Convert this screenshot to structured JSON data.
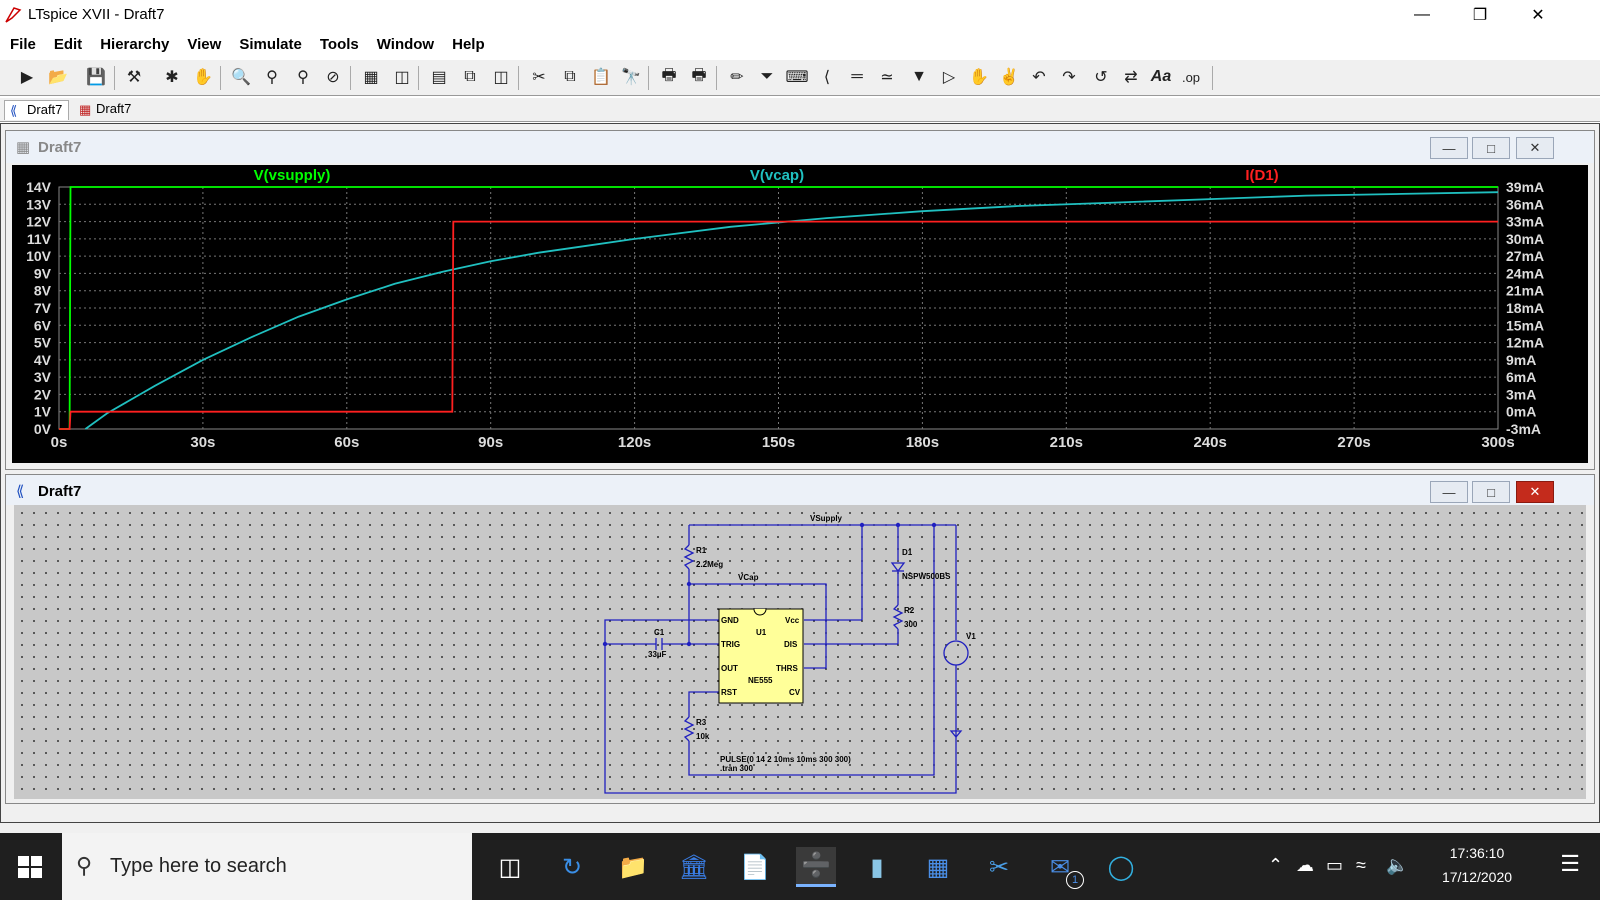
{
  "window": {
    "title": "LTspice XVII - Draft7"
  },
  "menu": [
    "File",
    "Edit",
    "Hierarchy",
    "View",
    "Simulate",
    "Tools",
    "Window",
    "Help"
  ],
  "toolbar": {
    "icons": [
      "run-icon",
      "open-icon",
      "save-icon",
      "control-panel-icon",
      "halt-icon",
      "pan-icon",
      "zoom-in-icon",
      "zoom-fit-icon",
      "zoom-out-icon",
      "zoom-cancel-icon",
      "autorange-icon",
      "grid-icon",
      "tile-horizontal-icon",
      "cascade-icon",
      "tile-vertical-icon",
      "cut-icon",
      "copy-icon",
      "paste-icon",
      "find-icon",
      "print-icon",
      "print-preview-icon",
      "wire-icon",
      "ground-icon",
      "label-net-icon",
      "resistor-icon",
      "capacitor-icon",
      "inductor-icon",
      "diode-icon",
      "component-icon",
      "move-icon",
      "drag-icon",
      "undo-icon",
      "redo-icon",
      "rotate-icon",
      "mirror-icon",
      "text-icon",
      "spice-directive-icon"
    ],
    "text_label": "Aa",
    "op_label": ".op"
  },
  "doc_tabs": [
    {
      "label": "Draft7",
      "kind": "schematic"
    },
    {
      "label": "Draft7",
      "kind": "waveform"
    }
  ],
  "wave_window": {
    "title": "Draft7",
    "traces": [
      {
        "name": "V(vsupply)",
        "color": "#00ff00"
      },
      {
        "name": "V(vcap)",
        "color": "#20c0c0"
      },
      {
        "name": "I(D1)",
        "color": "#ff2020"
      }
    ]
  },
  "chart_data": {
    "type": "line",
    "x_ticks": [
      "0s",
      "30s",
      "60s",
      "90s",
      "120s",
      "150s",
      "180s",
      "210s",
      "240s",
      "270s",
      "300s"
    ],
    "xlim": [
      0,
      300
    ],
    "y_left_ticks": [
      "14V",
      "13V",
      "12V",
      "11V",
      "10V",
      "9V",
      "8V",
      "7V",
      "6V",
      "5V",
      "4V",
      "3V",
      "2V",
      "1V",
      "0V"
    ],
    "ylim_left": [
      0,
      14
    ],
    "y_right_ticks": [
      "39mA",
      "36mA",
      "33mA",
      "30mA",
      "27mA",
      "24mA",
      "21mA",
      "18mA",
      "15mA",
      "12mA",
      "9mA",
      "6mA",
      "3mA",
      "0mA",
      "-3mA"
    ],
    "ylim_right": [
      -3,
      39
    ],
    "grid": true,
    "series": [
      {
        "name": "V(vsupply)",
        "axis": "left",
        "x": [
          0,
          2.2,
          2.4,
          300
        ],
        "y": [
          0,
          0,
          14,
          14
        ]
      },
      {
        "name": "V(vcap)",
        "axis": "left",
        "x": [
          5.5,
          10,
          20,
          30,
          40,
          50,
          60,
          70,
          80,
          90,
          100,
          110,
          120,
          140,
          160,
          180,
          200,
          220,
          240,
          260,
          280,
          300
        ],
        "y": [
          0,
          0.9,
          2.5,
          4.0,
          5.3,
          6.5,
          7.5,
          8.4,
          9.1,
          9.7,
          10.2,
          10.6,
          11.0,
          11.7,
          12.2,
          12.6,
          12.9,
          13.1,
          13.3,
          13.5,
          13.6,
          13.7
        ]
      },
      {
        "name": "I(D1)",
        "axis": "right",
        "x": [
          0,
          2.2,
          2.4,
          82,
          82.2,
          300
        ],
        "y": [
          -3,
          -3,
          0,
          0,
          33,
          33
        ]
      }
    ]
  },
  "sch_window": {
    "title": "Draft7",
    "labels": {
      "vsupply": "VSupply",
      "vcap": "VCap",
      "r1": "R1",
      "r1_val": "2.2Meg",
      "c1": "C1",
      "c1_val": "33µF",
      "u1": "U1",
      "u1_part": "NE555",
      "gnd": "GND",
      "trig": "TRIG",
      "out": "OUT",
      "rst": "RST",
      "vcc": "Vcc",
      "dis": "DIS",
      "thrs": "THRS",
      "cv": "CV",
      "d1": "D1",
      "d1_part": "NSPW500BS",
      "r2": "R2",
      "r2_val": "300",
      "r3": "R3",
      "r3_val": "10k",
      "v1": "V1",
      "pulse": "PULSE(0 14 2 10ms 10ms 300 300)",
      "tran": ".tran 300"
    }
  },
  "taskbar": {
    "search_placeholder": "Type here to search",
    "apps": [
      "task-view-icon",
      "control-panel-icon",
      "file-explorer-icon",
      "bank-icon",
      "notepad-icon",
      "ltspice-icon",
      "app-icon",
      "calculator-icon",
      "snipping-tool-icon",
      "mail-icon",
      "edge-icon"
    ],
    "mail_badge": "1",
    "time": "17:36:10",
    "date": "17/12/2020"
  }
}
